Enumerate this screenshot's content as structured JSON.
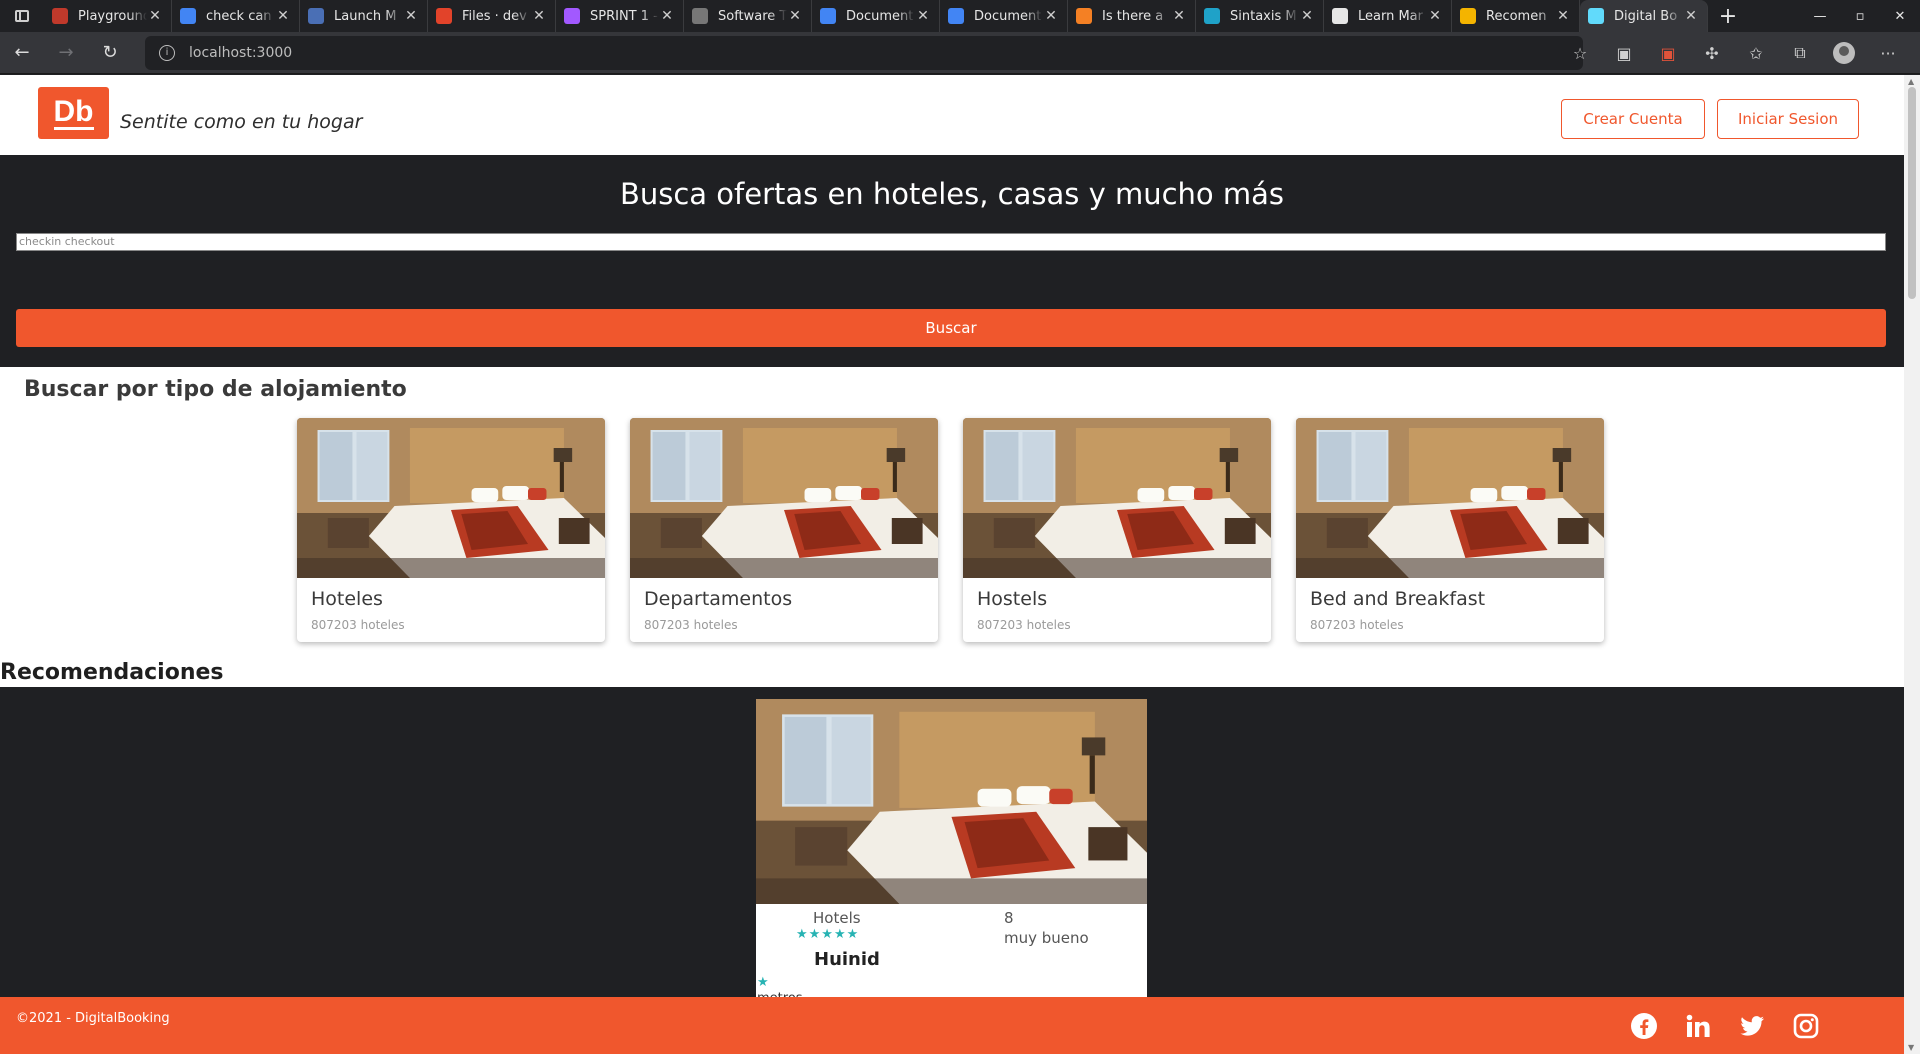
{
  "browser": {
    "tabs": [
      {
        "title": "Playground",
        "color": "#c0392b"
      },
      {
        "title": "check can",
        "color": "#4285f4"
      },
      {
        "title": "Launch M",
        "color": "#4a6fb5"
      },
      {
        "title": "Files · dev",
        "color": "#e2432a"
      },
      {
        "title": "SPRINT 1 -",
        "color": "#a259ff"
      },
      {
        "title": "Software T",
        "color": "#777777"
      },
      {
        "title": "Document",
        "color": "#4285f4"
      },
      {
        "title": "Document",
        "color": "#4285f4"
      },
      {
        "title": "Is there a",
        "color": "#f48024"
      },
      {
        "title": "Sintaxis M",
        "color": "#1fa2c8"
      },
      {
        "title": "Learn Mar",
        "color": "#e6e6e6"
      },
      {
        "title": "Recomen",
        "color": "#f4b400"
      },
      {
        "title": "Digital Bo",
        "color": "#61dafb"
      }
    ],
    "url": "localhost:3000"
  },
  "header": {
    "logo_text": "Db",
    "slogan": "Sentite como en tu hogar",
    "create_account": "Crear Cuenta",
    "login": "Iniciar Sesion"
  },
  "hero": {
    "title": "Busca ofertas en hoteles, casas y mucho más",
    "date_placeholder": "checkin checkout",
    "search_button": "Buscar"
  },
  "categories": {
    "title": "Buscar por tipo de alojamiento",
    "items": [
      {
        "name": "Hoteles",
        "count": "807203 hoteles"
      },
      {
        "name": "Departamentos",
        "count": "807203 hoteles"
      },
      {
        "name": "Hostels",
        "count": "807203 hoteles"
      },
      {
        "name": "Bed and Breakfast",
        "count": "807203 hoteles"
      }
    ]
  },
  "recommendations": {
    "title": "Recomendaciones",
    "items": [
      {
        "category": "Hotels",
        "stars": "★★★★★",
        "score": "8",
        "score_label": "muy bueno",
        "name": "Huinid",
        "small_star": "★",
        "extra": "metros"
      }
    ]
  },
  "footer": {
    "copyright": "©2021 - DigitalBooking",
    "social": [
      "facebook-icon",
      "linkedin-icon",
      "twitter-icon",
      "instagram-icon"
    ]
  },
  "colors": {
    "brand": "#f0572d",
    "dark": "#1f2023",
    "star": "#27b3b3"
  }
}
